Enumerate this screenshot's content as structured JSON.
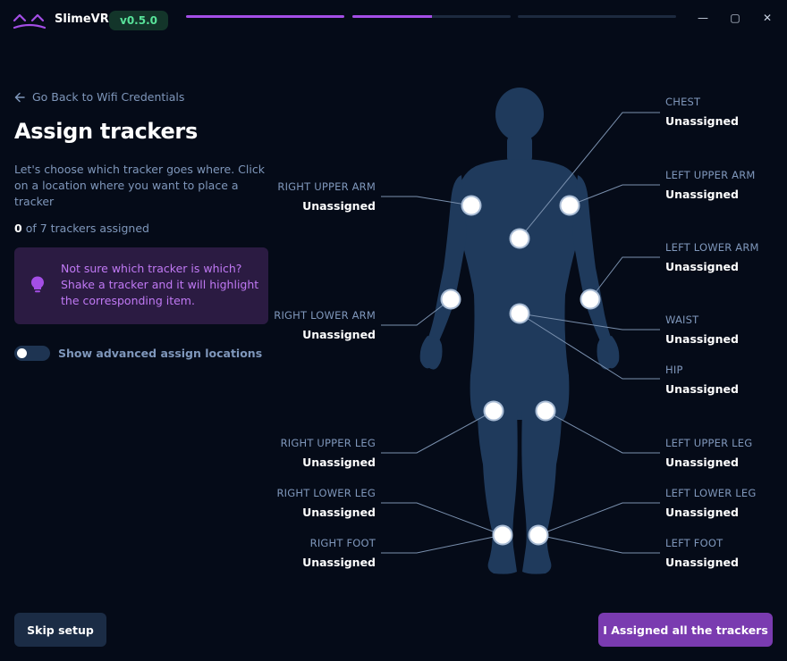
{
  "app": {
    "title": "SlimeVR",
    "version": "v0.5.0",
    "logo_icon": "slimevr-logo",
    "accent_color": "#a44ee6",
    "progress_steps": [
      1.0,
      0.5,
      0.0
    ]
  },
  "window_controls": {
    "minimize": "—",
    "maximize": "▢",
    "close": "✕"
  },
  "nav": {
    "back_label": "Go Back to Wifi Credentials",
    "back_icon": "arrow-left-icon"
  },
  "page": {
    "title": "Assign trackers",
    "description": "Let's choose which tracker goes where. Click on a location where you want to place a tracker",
    "assigned_count": "0",
    "assigned_suffix": "of 7 trackers assigned"
  },
  "tip": {
    "icon": "lightbulb-icon",
    "text": "Not sure which tracker is which? Shake a tracker and it will highlight the corresponding item."
  },
  "advanced_toggle": {
    "label": "Show advanced assign locations",
    "enabled": false
  },
  "body_parts": {
    "chest": {
      "name": "CHEST",
      "status": "Unassigned"
    },
    "left_upper_arm": {
      "name": "LEFT UPPER ARM",
      "status": "Unassigned"
    },
    "left_lower_arm": {
      "name": "LEFT LOWER ARM",
      "status": "Unassigned"
    },
    "waist": {
      "name": "WAIST",
      "status": "Unassigned"
    },
    "hip": {
      "name": "HIP",
      "status": "Unassigned"
    },
    "left_upper_leg": {
      "name": "LEFT UPPER LEG",
      "status": "Unassigned"
    },
    "left_lower_leg": {
      "name": "LEFT LOWER LEG",
      "status": "Unassigned"
    },
    "left_foot": {
      "name": "LEFT FOOT",
      "status": "Unassigned"
    },
    "right_upper_arm": {
      "name": "RIGHT UPPER ARM",
      "status": "Unassigned"
    },
    "right_lower_arm": {
      "name": "RIGHT LOWER ARM",
      "status": "Unassigned"
    },
    "right_upper_leg": {
      "name": "RIGHT UPPER LEG",
      "status": "Unassigned"
    },
    "right_lower_leg": {
      "name": "RIGHT LOWER LEG",
      "status": "Unassigned"
    },
    "right_foot": {
      "name": "RIGHT FOOT",
      "status": "Unassigned"
    }
  },
  "buttons": {
    "skip": "Skip setup",
    "done": "I Assigned all the trackers"
  }
}
